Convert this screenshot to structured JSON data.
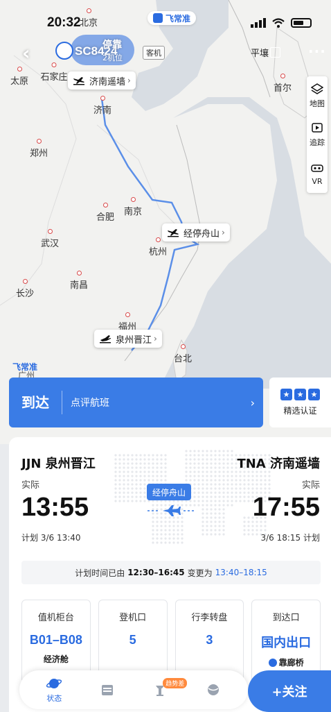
{
  "status_bar": {
    "time": "20:32"
  },
  "watermark": "飞常准",
  "header": {
    "flight_number": "SC8424",
    "status": "停靠",
    "sub_status": "2机位",
    "tag": "客机",
    "share_label": "平壤"
  },
  "map": {
    "cities": [
      {
        "name": "北京"
      },
      {
        "name": "太原"
      },
      {
        "name": "石家庄"
      },
      {
        "name": "首尔"
      },
      {
        "name": "济南"
      },
      {
        "name": "郑州"
      },
      {
        "name": "南京"
      },
      {
        "name": "合肥"
      },
      {
        "name": "武汉"
      },
      {
        "name": "杭州"
      },
      {
        "name": "南昌"
      },
      {
        "name": "长沙"
      },
      {
        "name": "福州"
      },
      {
        "name": "台北"
      },
      {
        "name": "广州"
      }
    ],
    "labels": {
      "destination": "济南遥墙",
      "stopover": "经停舟山",
      "origin": "泉州晋江"
    },
    "tools": [
      {
        "label": "地图",
        "icon": "layers-icon"
      },
      {
        "label": "追踪",
        "icon": "video-track-icon"
      },
      {
        "label": "VR",
        "icon": "vr-headset-icon"
      }
    ]
  },
  "arrival_bar": {
    "status": "到达",
    "review": "点评航班"
  },
  "certified": {
    "label": "精选认证"
  },
  "flight": {
    "from": "JJN 泉州晋江",
    "to": "TNA 济南遥墙",
    "actual_label_left": "实际",
    "actual_label_right": "实际",
    "dep_time": "13:55",
    "arr_time": "17:55",
    "dep_plan": "计划 3/6 13:40",
    "arr_plan": "3/6 18:15 计划",
    "stopover": "经停舟山",
    "change_note_prefix": "计划时间已由",
    "change_note_old": "12:30–16:45",
    "change_note_mid": "变更为",
    "change_note_new": "13:40–18:15"
  },
  "info": [
    {
      "label": "值机柜台",
      "value": "B01–B08",
      "sub": "经济舱"
    },
    {
      "label": "登机口",
      "value": "5",
      "sub": ""
    },
    {
      "label": "行李转盘",
      "value": "3",
      "sub": ""
    },
    {
      "label": "到达口",
      "value": "国内出口",
      "sub": "靠廊桥"
    }
  ],
  "bottom_nav": {
    "items": [
      {
        "label": "状态",
        "icon": "planet-icon"
      },
      {
        "label": "",
        "icon": "calendar-icon"
      },
      {
        "label": "",
        "icon": "tower-icon",
        "badge": "趋势差"
      },
      {
        "label": "",
        "icon": "globe-icon"
      }
    ],
    "follow": "+关注"
  }
}
